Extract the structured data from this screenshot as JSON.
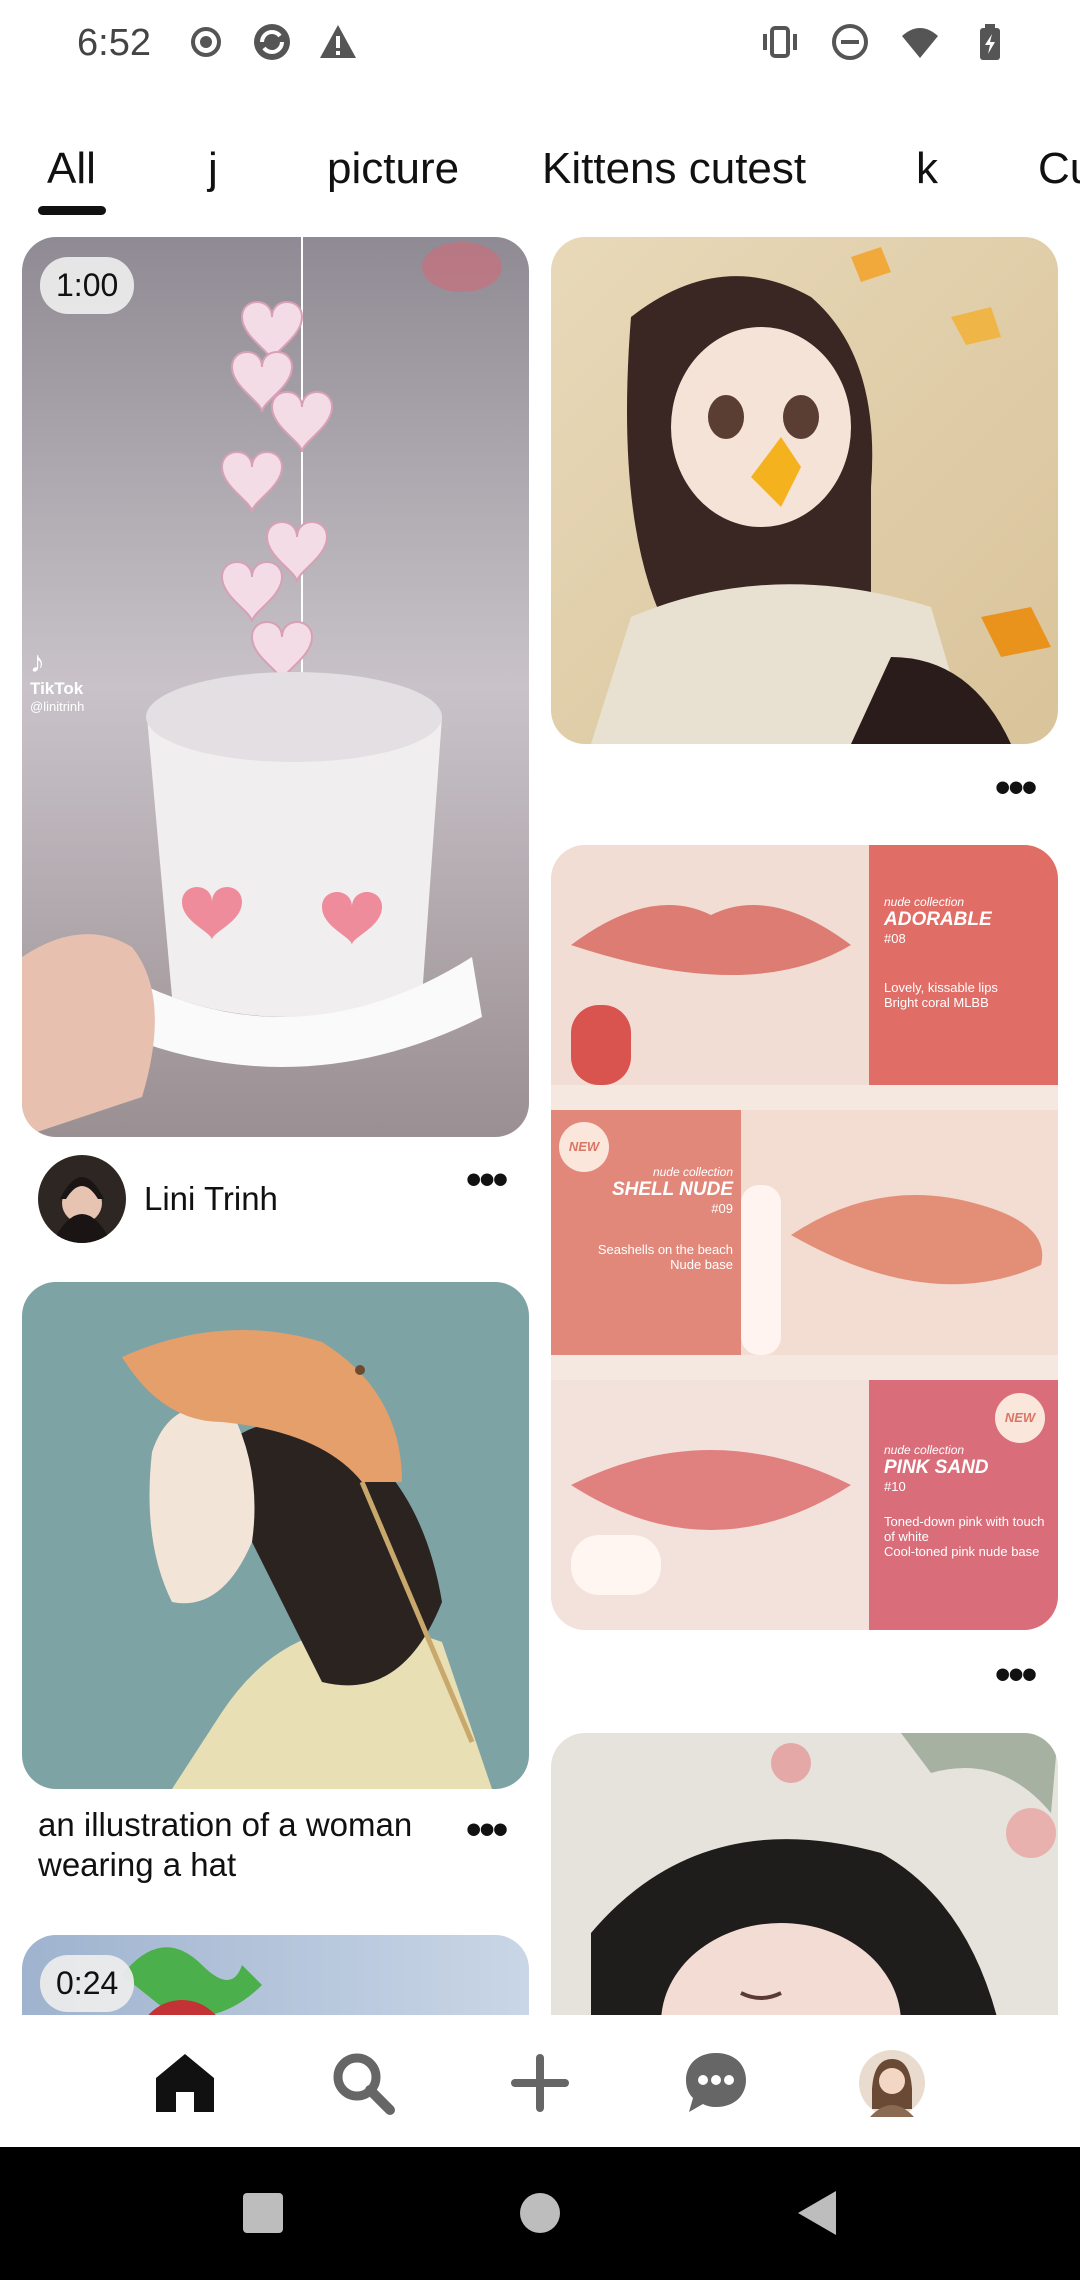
{
  "status_bar": {
    "time": "6:52",
    "left_icons": [
      "record-icon",
      "sync-icon",
      "warning-icon"
    ],
    "right_icons": [
      "vibrate-icon",
      "do-not-disturb-icon",
      "wifi-icon",
      "battery-charging-icon"
    ]
  },
  "tabs": {
    "items": [
      "All",
      "j",
      "picture",
      "Kittens cutest",
      "k",
      "Cu"
    ],
    "selected": "All"
  },
  "feed": {
    "pins": [
      {
        "id": "pin-video-1",
        "duration": "1:00",
        "watermark_brand": "TikTok",
        "watermark_handle": "@linitrinh",
        "author": "Lini Trinh",
        "more": "•••"
      },
      {
        "id": "pin-anime-girl",
        "more": "•••"
      },
      {
        "id": "pin-lipstick",
        "more": "•••",
        "panels": [
          {
            "collection": "nude collection",
            "name": "ADORABLE",
            "code": "#08",
            "desc1": "Lovely, kissable lips",
            "desc2": "Bright coral MLBB"
          },
          {
            "badge": "NEW",
            "collection": "nude collection",
            "name": "SHELL NUDE",
            "code": "#09",
            "desc1": "Seashells on the beach",
            "desc2": "Nude base"
          },
          {
            "badge": "NEW",
            "collection": "nude collection",
            "name": "PINK SAND",
            "code": "#10",
            "desc1": "Toned-down pink with touch of white",
            "desc2": "Cool-toned pink nude base"
          }
        ]
      },
      {
        "id": "pin-illustration",
        "caption": "an illustration of a woman wearing a hat",
        "more": "•••"
      },
      {
        "id": "pin-video-2",
        "duration": "0:24"
      },
      {
        "id": "pin-sleeping-girl"
      }
    ]
  },
  "bottom_nav": {
    "items": [
      "home-icon",
      "search-icon",
      "create-icon",
      "messages-icon",
      "profile-avatar"
    ],
    "selected": "home-icon"
  },
  "colors": {
    "text": "#111111",
    "lip_coral": "#e07a6c",
    "swatch_pink": "#d97777"
  }
}
